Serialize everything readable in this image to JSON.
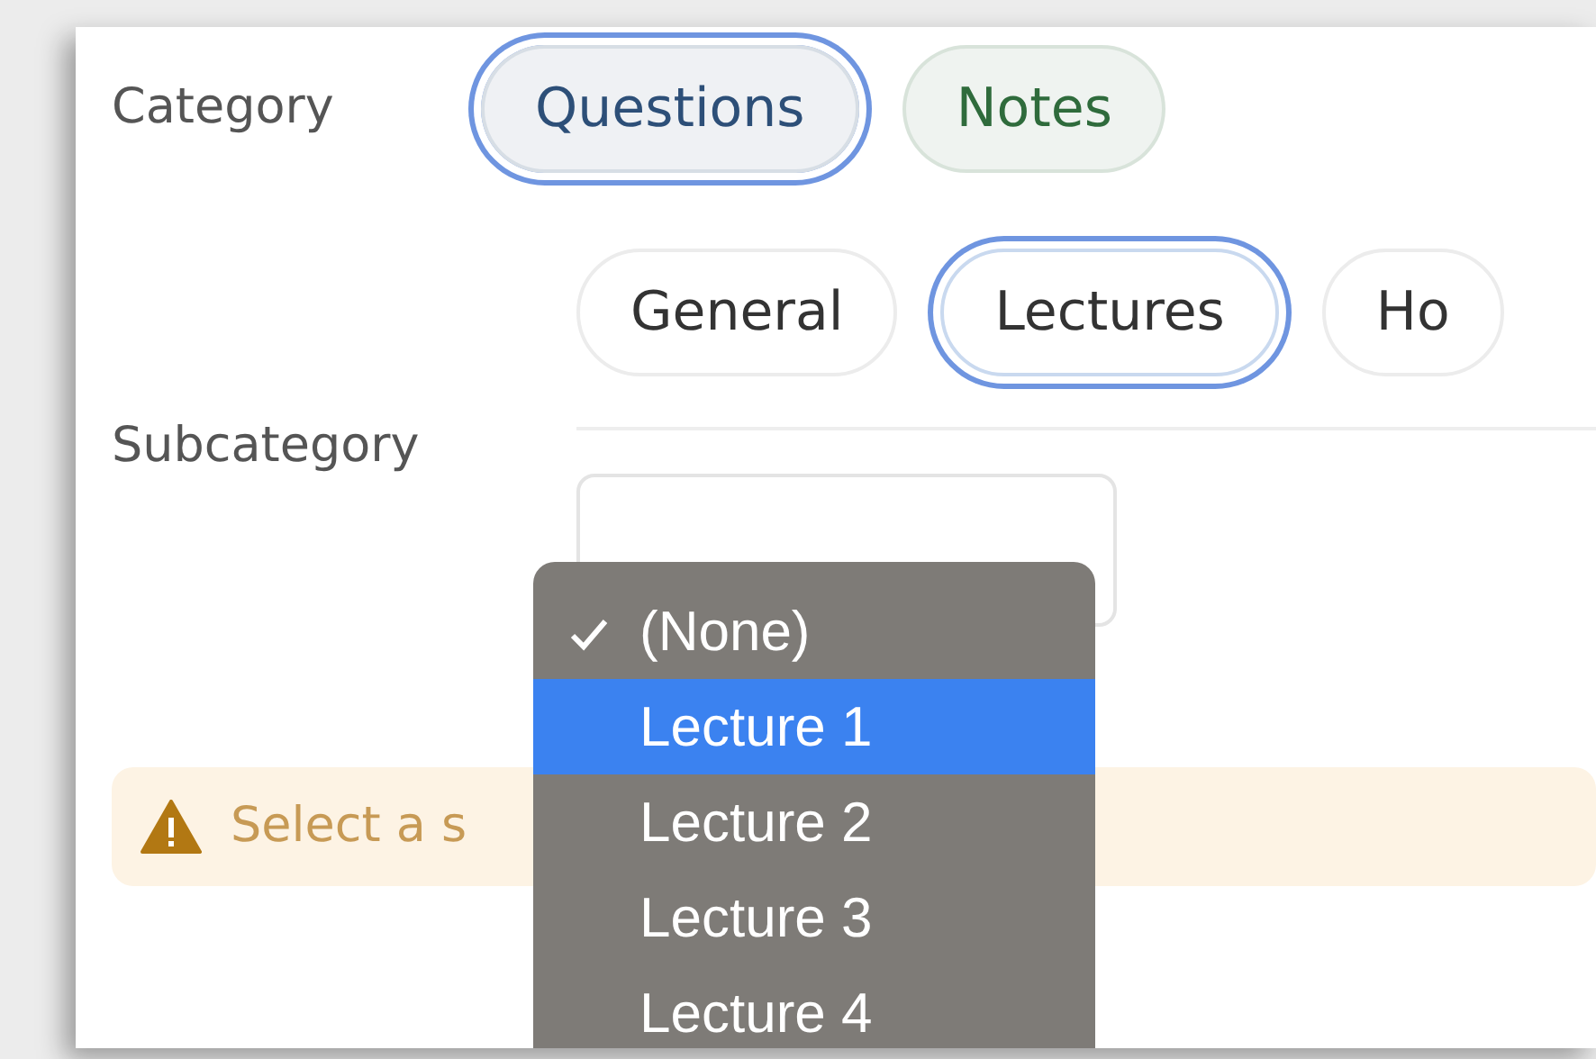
{
  "category": {
    "label": "Category",
    "options": [
      {
        "label": "Questions",
        "selected": true,
        "color": "#2d4f78"
      },
      {
        "label": "Notes",
        "selected": false,
        "color": "#2f6b3c"
      }
    ]
  },
  "subcategory": {
    "label": "Subcategory",
    "options": [
      {
        "label": "General",
        "selected": false
      },
      {
        "label": "Lectures",
        "selected": true
      },
      {
        "label": "Ho",
        "selected": false
      }
    ]
  },
  "alert": {
    "kind": "warning",
    "text": "Select a s"
  },
  "dropdown": {
    "items": [
      {
        "label": "(None)",
        "checked": true,
        "highlighted": false
      },
      {
        "label": "Lecture 1",
        "checked": false,
        "highlighted": true
      },
      {
        "label": "Lecture 2",
        "checked": false,
        "highlighted": false
      },
      {
        "label": "Lecture 3",
        "checked": false,
        "highlighted": false
      },
      {
        "label": "Lecture 4",
        "checked": false,
        "highlighted": false
      }
    ]
  }
}
